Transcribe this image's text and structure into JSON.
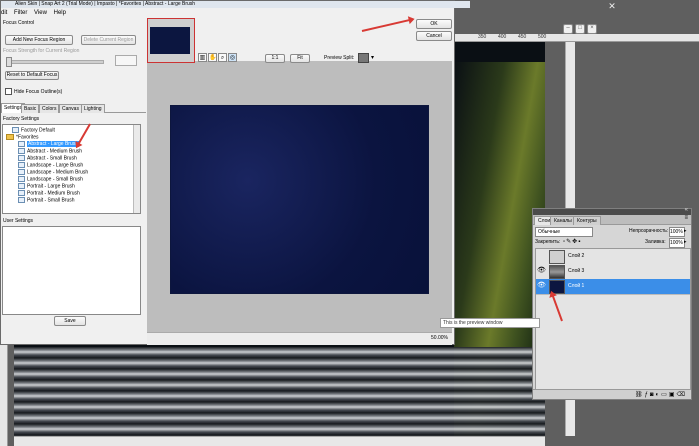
{
  "photoshop": {
    "ruler_ticks": [
      "350",
      "400",
      "450",
      "500"
    ],
    "close_glyph": "✕"
  },
  "layers_panel": {
    "tabs": [
      "Слои",
      "Каналы",
      "Контуры"
    ],
    "blend_mode": "Обычные",
    "opacity_label": "Непрозрачность:",
    "opacity_value": "100%",
    "lock_label": "Закрепить:",
    "fill_label": "Заливка:",
    "fill_value": "100%",
    "layers": [
      {
        "name": "Слой 2",
        "selected": false,
        "visible": false
      },
      {
        "name": "Слой 3",
        "selected": false,
        "visible": true
      },
      {
        "name": "Слой 1",
        "selected": true,
        "visible": true
      }
    ],
    "collapse_glyph": "«",
    "menu_glyph": "≡"
  },
  "dialog": {
    "title": "Alien Skin | Snap Art 2 (Trial Mode) | Impasto | *Favorites | Abstract - Large Brush",
    "menu": [
      "dit",
      "Filter",
      "View",
      "Help"
    ],
    "focus_control_label": "Focus Control",
    "add_focus_region": "Add New Focus Region",
    "delete_focus_region": "Delete Current Region",
    "focus_strength_label": "Focus Strength for Current Region",
    "reset_default_focus": "Reset to Default Focus",
    "hide_focus_outlines": "Hide Focus Outline(s)",
    "tabs": [
      "Settings",
      "Basic",
      "Colors",
      "Canvas",
      "Lighting"
    ],
    "factory_settings_label": "Factory Settings",
    "tree": [
      {
        "label": "Factory Default",
        "kind": "file",
        "indent": 1,
        "selected": false
      },
      {
        "label": "*Favorites",
        "kind": "folder",
        "indent": 0,
        "selected": false
      },
      {
        "label": "Abstract - Large Brush",
        "kind": "file",
        "indent": 2,
        "selected": true
      },
      {
        "label": "Abstract - Medium Brush",
        "kind": "file",
        "indent": 2,
        "selected": false
      },
      {
        "label": "Abstract - Small Brush",
        "kind": "file",
        "indent": 2,
        "selected": false
      },
      {
        "label": "Landscape - Large Brush",
        "kind": "file",
        "indent": 2,
        "selected": false
      },
      {
        "label": "Landscape - Medium Brush",
        "kind": "file",
        "indent": 2,
        "selected": false
      },
      {
        "label": "Landscape - Small Brush",
        "kind": "file",
        "indent": 2,
        "selected": false
      },
      {
        "label": "Portrait - Large Brush",
        "kind": "file",
        "indent": 2,
        "selected": false
      },
      {
        "label": "Portrait - Medium Brush",
        "kind": "file",
        "indent": 2,
        "selected": false
      },
      {
        "label": "Portrait - Small Brush",
        "kind": "file",
        "indent": 2,
        "selected": false
      }
    ],
    "user_settings_label": "User Settings",
    "save": "Save",
    "ok": "OK",
    "cancel": "Cancel",
    "zoom_1_1": "1:1",
    "zoom_fit": "Fit",
    "preview_split_label": "Preview Split:",
    "preview_tooltip": "This is the preview window",
    "zoom_level": "50.00%"
  }
}
